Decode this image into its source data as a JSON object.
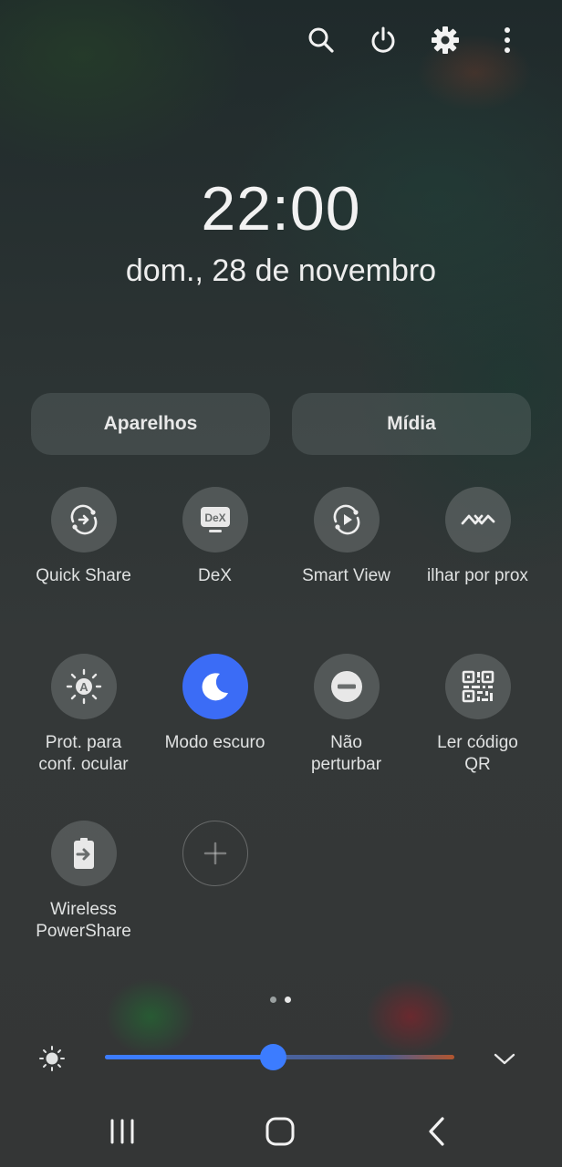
{
  "top_actions": [
    {
      "name": "search-icon"
    },
    {
      "name": "power-icon"
    },
    {
      "name": "settings-icon"
    },
    {
      "name": "more-options-icon"
    }
  ],
  "clock": {
    "time": "22:00",
    "date": "dom., 28 de novembro"
  },
  "pills": {
    "devices": "Aparelhos",
    "media": "Mídia"
  },
  "tiles": [
    {
      "label": "Quick Share",
      "icon": "quick-share-icon",
      "on": false
    },
    {
      "label": "DeX",
      "icon": "dex-icon",
      "on": false
    },
    {
      "label": "Smart View",
      "icon": "smart-view-icon",
      "on": false
    },
    {
      "label": "ilhar por prox",
      "icon": "nearby-share-icon",
      "on": false
    },
    {
      "label": "Prot. para\nconf. ocular",
      "icon": "eye-comfort-icon",
      "on": false
    },
    {
      "label": "Modo escuro",
      "icon": "moon-icon",
      "on": true
    },
    {
      "label": "Não\nperturbar",
      "icon": "do-not-disturb-icon",
      "on": false
    },
    {
      "label": "Ler código\nQR",
      "icon": "qr-code-icon",
      "on": false
    },
    {
      "label": "Wireless\nPowerShare",
      "icon": "battery-share-icon",
      "on": false
    }
  ],
  "pagination": {
    "pages": 2,
    "current": 2
  },
  "brightness": {
    "level": 0.48
  },
  "colors": {
    "accent": "#3c7cff",
    "active_tile": "#3b6cf6"
  },
  "nav": [
    {
      "name": "recent-apps-icon"
    },
    {
      "name": "home-icon"
    },
    {
      "name": "back-icon"
    }
  ]
}
